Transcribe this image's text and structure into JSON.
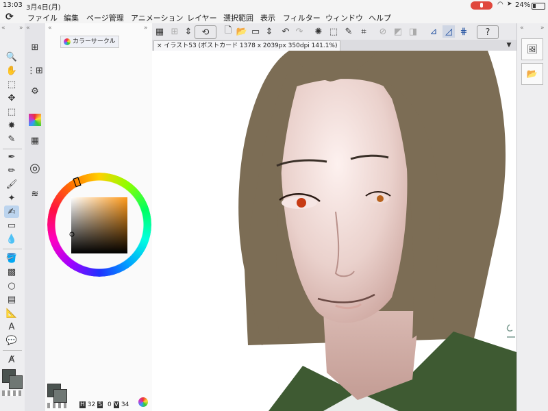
{
  "status": {
    "time": "13:03",
    "date": "3月4日(月)",
    "battery": "24%"
  },
  "menu": [
    "ファイル",
    "編集",
    "ページ管理",
    "アニメーション",
    "レイヤー",
    "選択範囲",
    "表示",
    "フィルター",
    "ウィンドウ",
    "ヘルプ"
  ],
  "color_panel": {
    "tab_label": "カラーサークル"
  },
  "document": {
    "tab_label": "イラスト53 (ポストカード 1378 x 2039px 350dpi 141.1%)"
  },
  "color_info": {
    "h_label": "H",
    "h_value": "32",
    "s_label": "S",
    "s_value": "0",
    "v_label": "V",
    "v_value": "34"
  },
  "colors": {
    "main": "#4a5350",
    "sub": "#6f7774",
    "hair": "#7c6d55",
    "coat": "#3e5a32",
    "selected_hue": "#ff9a1a"
  }
}
